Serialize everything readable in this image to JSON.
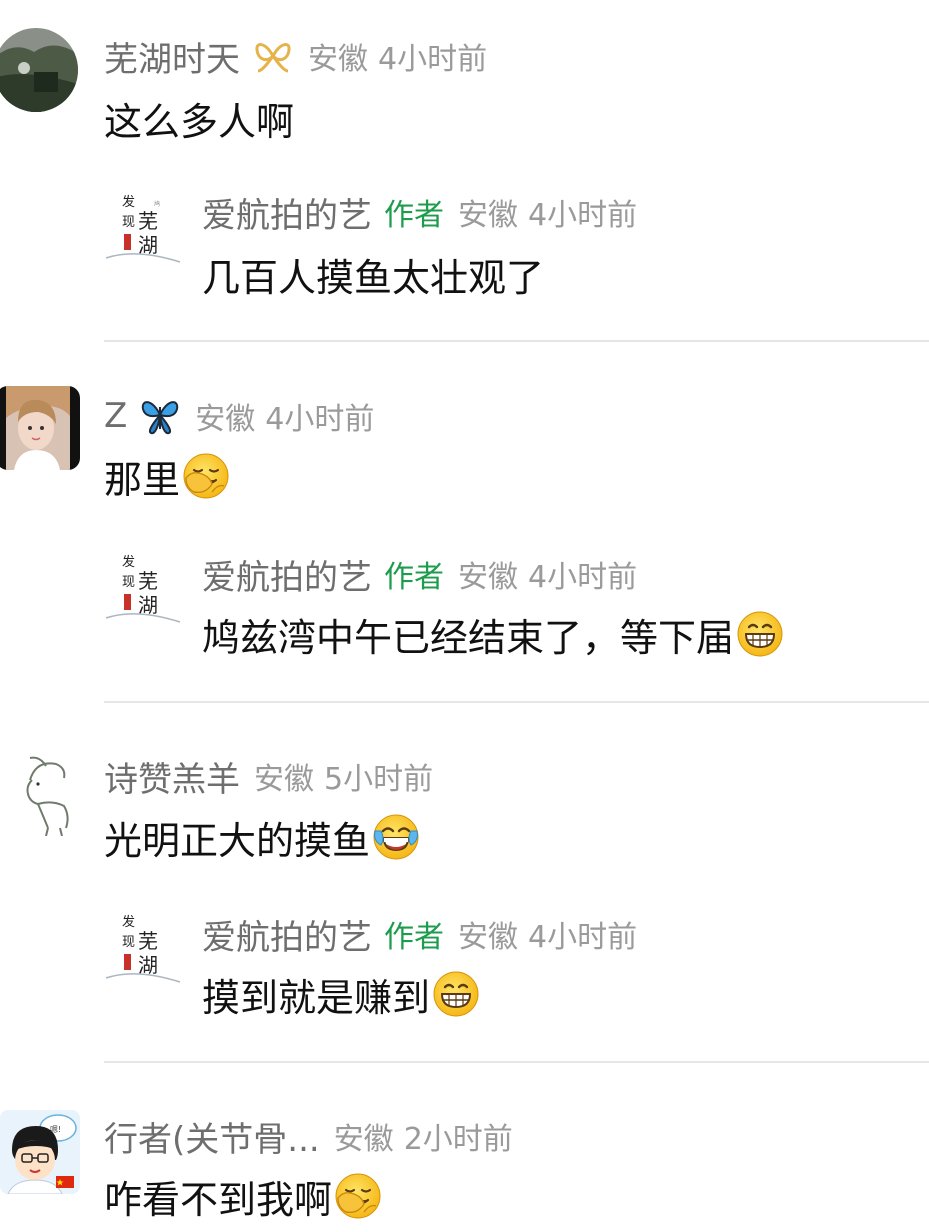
{
  "comments": [
    {
      "user": "芜湖时天",
      "badge": "gold-ribbon-icon",
      "location": "安徽",
      "time": "4小时前",
      "text": "这么多人啊",
      "reply": {
        "user": "爱航拍的艺",
        "tag": "作者",
        "location": "安徽",
        "time": "4小时前",
        "text": "几百人摸鱼太壮观了"
      }
    },
    {
      "user": "Z",
      "badge": "blue-butterfly-icon",
      "location": "安徽",
      "time": "4小时前",
      "text": "那里",
      "emoji": "facepalm-emoji",
      "reply": {
        "user": "爱航拍的艺",
        "tag": "作者",
        "location": "安徽",
        "time": "4小时前",
        "text": "鸠兹湾中午已经结束了，等下届",
        "emoji": "grin-emoji"
      }
    },
    {
      "user": "诗赞羔羊",
      "location": "安徽",
      "time": "5小时前",
      "text": "光明正大的摸鱼",
      "emoji": "tears-of-joy-emoji",
      "reply": {
        "user": "爱航拍的艺",
        "tag": "作者",
        "location": "安徽",
        "time": "4小时前",
        "text": "摸到就是赚到",
        "emoji": "grin-emoji"
      }
    },
    {
      "user": "行者(关节骨...",
      "location": "安徽",
      "time": "2小时前",
      "text": "咋看不到我啊",
      "emoji": "facepalm-emoji"
    }
  ],
  "colors": {
    "username": "#6e6e6e",
    "meta": "#9a9a9a",
    "author_tag": "#1e9c4e",
    "text": "#111111",
    "divider": "#e6e6e6"
  }
}
